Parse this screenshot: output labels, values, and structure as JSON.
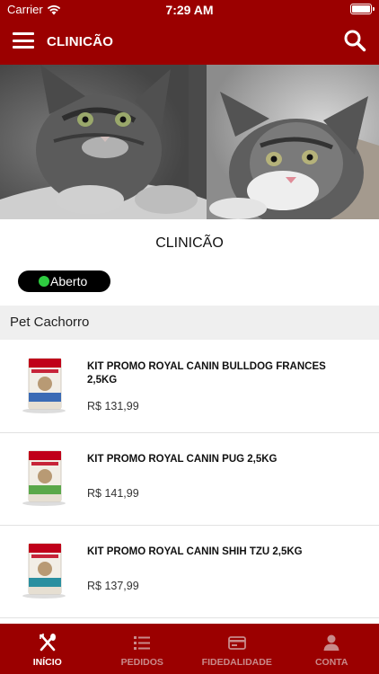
{
  "status_bar": {
    "carrier": "Carrier",
    "time": "7:29 AM"
  },
  "header": {
    "title": "CLINICÃO",
    "brand_color": "#9b0000"
  },
  "store": {
    "name": "CLINICÃO",
    "status_label": "Aberto",
    "status_color": "#2ecc40"
  },
  "category": {
    "name": "Pet Cachorro"
  },
  "products": [
    {
      "name": "KIT PROMO ROYAL CANIN  BULLDOG FRANCES 2,5KG",
      "price": "R$ 131,99",
      "pack_color": "#3b6bb5",
      "pack_label": "Bulldog Frances"
    },
    {
      "name": "KIT PROMO ROYAL CANIN PUG 2,5KG",
      "price": "R$ 141,99",
      "pack_color": "#5aa84a",
      "pack_label": "Pug"
    },
    {
      "name": "KIT PROMO ROYAL CANIN SHIH TZU 2,5KG",
      "price": "R$ 137,99",
      "pack_color": "#2a8fa0",
      "pack_label": "Shih Tzu"
    }
  ],
  "tabs": [
    {
      "label": "INÍCIO",
      "icon": "cutlery-icon",
      "active": true
    },
    {
      "label": "PEDIDOS",
      "icon": "list-icon",
      "active": false
    },
    {
      "label": "FIDEDALIDADE",
      "icon": "loyalty-card-icon",
      "active": false
    },
    {
      "label": "CONTA",
      "icon": "user-icon",
      "active": false
    }
  ]
}
